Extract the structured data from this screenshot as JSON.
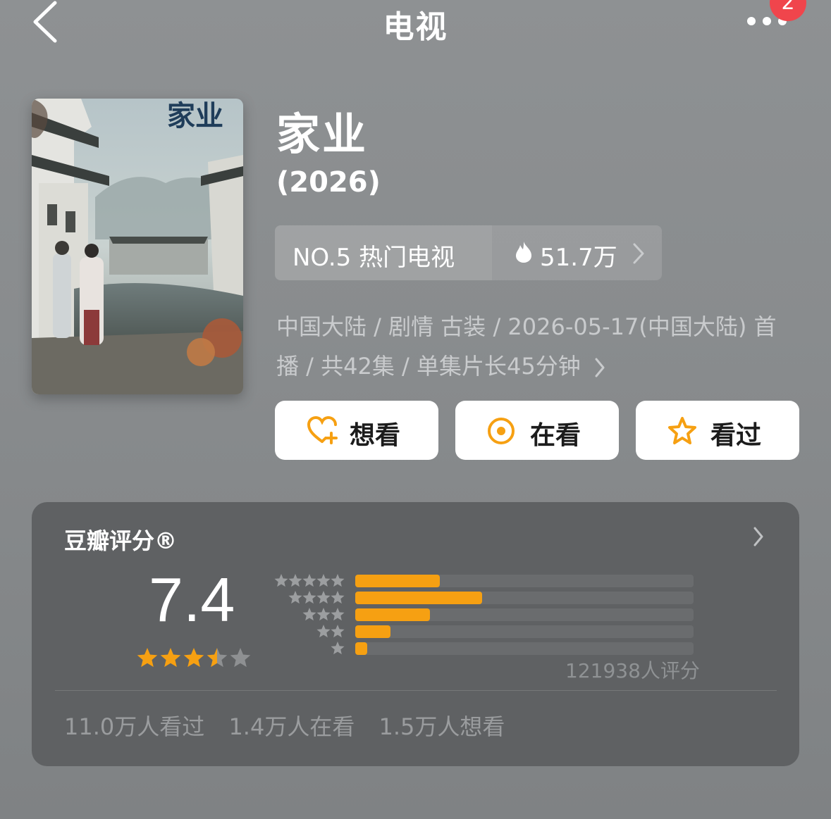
{
  "nav": {
    "title": "电视",
    "badge": "2"
  },
  "poster": {
    "title_text": "家业"
  },
  "subject": {
    "title": "家业",
    "year": "(2026)",
    "rank_label": "NO.5 热门电视",
    "heat": "51.7万",
    "meta_line1": "中国大陆 / 剧情 古装 / 2026-05-17(中国大陆) 首",
    "meta_line2": "播 / 共42集 / 单集片长45分钟"
  },
  "actions": {
    "want": "想看",
    "doing": "在看",
    "done": "看过"
  },
  "rating": {
    "title": "豆瓣评分®",
    "score": "7.4",
    "stars": 3.5,
    "count_text": "121938人评分",
    "distribution": [
      {
        "stars": 5,
        "fraction": 0.25
      },
      {
        "stars": 4,
        "fraction": 0.375
      },
      {
        "stars": 3,
        "fraction": 0.22
      },
      {
        "stars": 2,
        "fraction": 0.105
      },
      {
        "stars": 1,
        "fraction": 0.035
      }
    ],
    "stats": [
      "11.0万人看过",
      "1.4万人在看",
      "1.5万人想看"
    ]
  },
  "colors": {
    "accent": "#f6a012",
    "badge": "#f0454c",
    "card": "#5f6163"
  }
}
